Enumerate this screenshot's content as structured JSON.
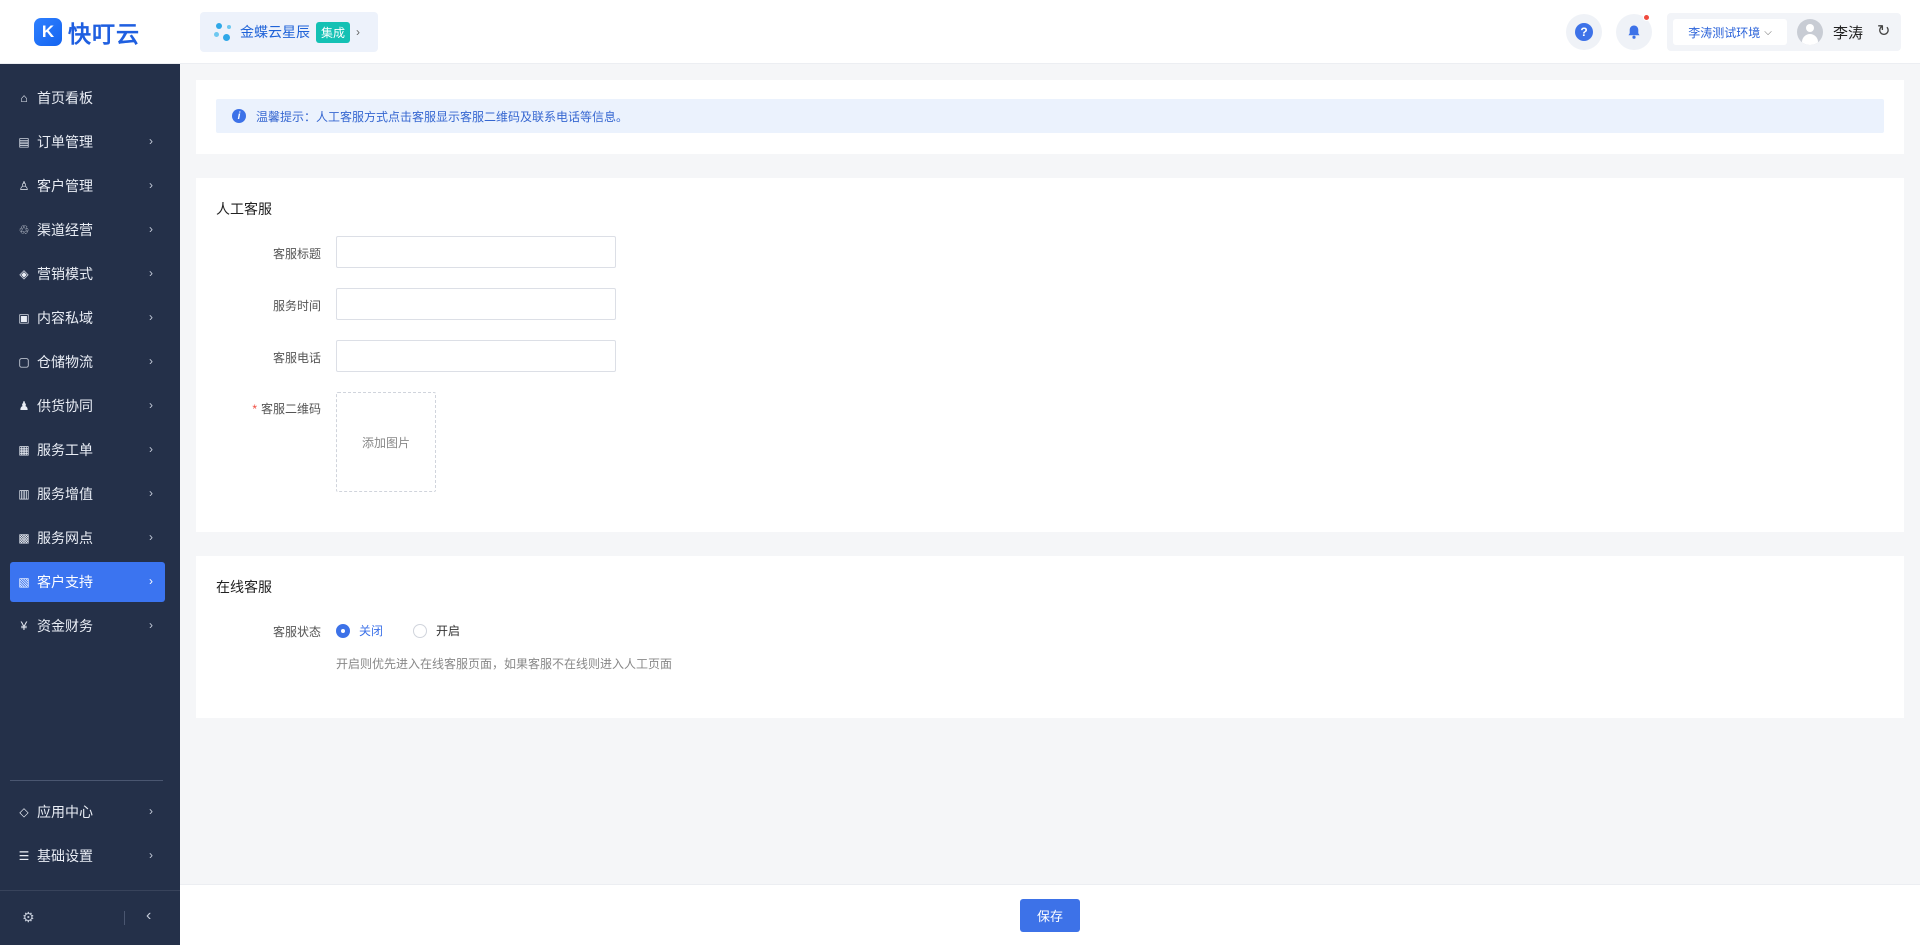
{
  "app": {
    "logo_mark": "K",
    "logo_text": "快叮云"
  },
  "brand": {
    "name": "金蝶云星辰",
    "badge": "集成"
  },
  "header": {
    "env_select": "李涛测试环境",
    "user_name": "李涛",
    "icons": {
      "help": "question-circle-icon",
      "notify": "bell-icon",
      "refresh": "refresh-icon"
    }
  },
  "sidebar": {
    "items": [
      {
        "label": "首页看板",
        "icon": "⌂",
        "chevron": false,
        "active": false
      },
      {
        "label": "订单管理",
        "icon": "▤",
        "chevron": true,
        "active": false
      },
      {
        "label": "客户管理",
        "icon": "♙",
        "chevron": true,
        "active": false
      },
      {
        "label": "渠道经营",
        "icon": "♲",
        "chevron": true,
        "active": false
      },
      {
        "label": "营销模式",
        "icon": "◈",
        "chevron": true,
        "active": false
      },
      {
        "label": "内容私域",
        "icon": "▣",
        "chevron": true,
        "active": false
      },
      {
        "label": "仓储物流",
        "icon": "▢",
        "chevron": true,
        "active": false
      },
      {
        "label": "供货协同",
        "icon": "♟",
        "chevron": true,
        "active": false
      },
      {
        "label": "服务工单",
        "icon": "▦",
        "chevron": true,
        "active": false
      },
      {
        "label": "服务增值",
        "icon": "▥",
        "chevron": true,
        "active": false
      },
      {
        "label": "服务网点",
        "icon": "▩",
        "chevron": true,
        "active": false
      },
      {
        "label": "客户支持",
        "icon": "▧",
        "chevron": true,
        "active": true
      },
      {
        "label": "资金财务",
        "icon": "¥",
        "chevron": true,
        "active": false
      }
    ],
    "bottom_items": [
      {
        "label": "应用中心",
        "icon": "◇",
        "chevron": true
      },
      {
        "label": "基础设置",
        "icon": "☰",
        "chevron": true
      }
    ]
  },
  "notice": {
    "text": "温馨提示：人工客服方式点击客服显示客服二维码及联系电话等信息。"
  },
  "manual_service": {
    "title": "人工客服",
    "fields": [
      {
        "label": "客服标题",
        "value": ""
      },
      {
        "label": "服务时间",
        "value": ""
      },
      {
        "label": "客服电话",
        "value": ""
      }
    ],
    "qr_label": "客服二维码",
    "qr_required": "*",
    "upload_text": "添加图片"
  },
  "online_service": {
    "title": "在线客服",
    "status_label": "客服状态",
    "options": [
      {
        "label": "关闭",
        "checked": true
      },
      {
        "label": "开启",
        "checked": false
      }
    ],
    "hint": "开启则优先进入在线客服页面，如果客服不在线则进入人工页面"
  },
  "footer": {
    "save_label": "保存"
  },
  "colors": {
    "primary": "#3d72e8",
    "sidebar_bg": "#243049",
    "badge": "#14c1b4",
    "notice_bg": "#ebf2fd"
  }
}
